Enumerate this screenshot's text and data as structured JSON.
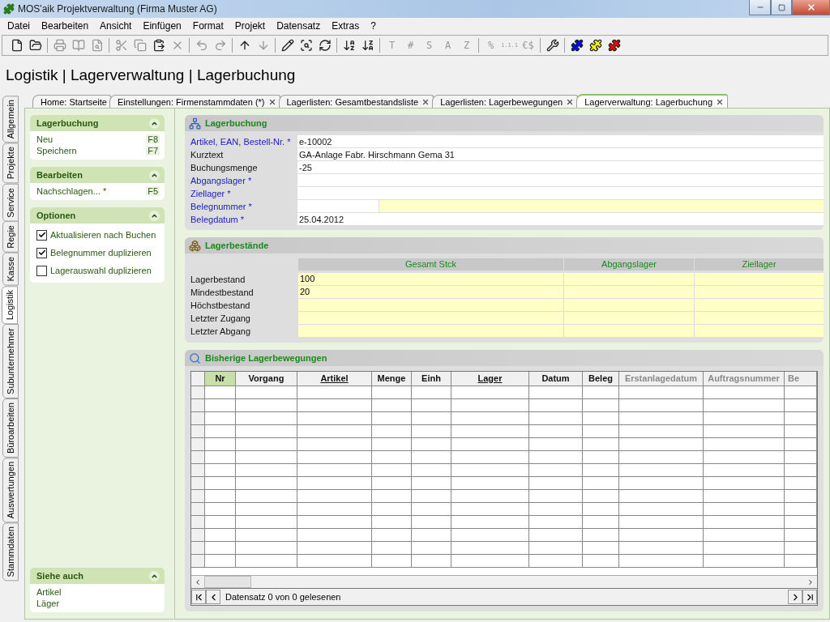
{
  "window": {
    "title": "MOS'aik Projektverwaltung (Firma Muster AG)"
  },
  "menu": [
    "Datei",
    "Bearbeiten",
    "Ansicht",
    "Einfügen",
    "Format",
    "Projekt",
    "Datensatz",
    "Extras",
    "?"
  ],
  "toolbar": [
    [
      {
        "disabled": false
      },
      {
        "disabled": false
      }
    ],
    [
      {
        "disabled": true
      },
      {
        "disabled": true
      },
      {
        "disabled": true
      }
    ],
    [
      {
        "disabled": true
      },
      {
        "disabled": true
      },
      {
        "disabled": false
      },
      {
        "disabled": true
      }
    ],
    [
      {
        "disabled": true
      },
      {
        "disabled": true
      }
    ],
    [
      {
        "disabled": false
      },
      {
        "disabled": true
      }
    ],
    [
      {
        "disabled": false
      },
      {
        "disabled": false
      },
      {
        "disabled": false
      }
    ],
    [
      {
        "disabled": false
      },
      {
        "disabled": false
      }
    ],
    [
      {
        "label": "T",
        "disabled": true
      },
      {
        "label": "#",
        "disabled": true
      },
      {
        "label": "S",
        "disabled": true
      },
      {
        "label": "A",
        "disabled": true
      },
      {
        "label": "Z",
        "disabled": true
      }
    ],
    [
      {
        "label": "%",
        "disabled": true
      },
      {
        "label": "1.1.1",
        "disabled": true
      },
      {
        "label": "€$",
        "disabled": true
      }
    ],
    [
      {
        "disabled": false
      }
    ],
    [
      {
        "color": "#0000ff"
      },
      {
        "color": "#ffff00"
      },
      {
        "color": "#ff0000"
      }
    ]
  ],
  "heading": "Logistik | Lagerverwaltung | Lagerbuchung",
  "doc_tabs": [
    {
      "label": "Home: Startseite",
      "selected": false,
      "closable": false
    },
    {
      "label": "Einstellungen: Firmenstammdaten (*)",
      "selected": false,
      "closable": true
    },
    {
      "label": "Lagerlisten: Gesamtbestandsliste",
      "selected": false,
      "closable": true
    },
    {
      "label": "Lagerlisten: Lagerbewegungen",
      "selected": false,
      "closable": true
    },
    {
      "label": "Lagerverwaltung: Lagerbuchung",
      "selected": true,
      "closable": true
    }
  ],
  "side_tabs": [
    {
      "label": "Allgemein",
      "selected": false
    },
    {
      "label": "Projekte",
      "selected": false
    },
    {
      "label": "Service",
      "selected": false
    },
    {
      "label": "Regie",
      "selected": false
    },
    {
      "label": "Kasse",
      "selected": false
    },
    {
      "label": "Logistik",
      "selected": true
    },
    {
      "label": "Subunternehmer",
      "selected": false
    },
    {
      "label": "Büroarbeiten",
      "selected": false
    },
    {
      "label": "Auswertungen",
      "selected": false
    },
    {
      "label": "Stammdaten",
      "selected": false
    }
  ],
  "task_panel": [
    {
      "title": "Lagerbuchung",
      "items": [
        {
          "label": "Neu",
          "shortcut": "F8"
        },
        {
          "label": "Speichern",
          "shortcut": "F7"
        }
      ]
    },
    {
      "title": "Bearbeiten",
      "items": [
        {
          "label": "Nachschlagen... *",
          "shortcut": "F5"
        }
      ]
    },
    {
      "title": "Optionen",
      "options": [
        {
          "label": "Aktualisieren nach Buchen",
          "checked": true
        },
        {
          "label": "Belegnummer duplizieren",
          "checked": true
        },
        {
          "label": "Lagerauswahl duplizieren",
          "checked": false
        }
      ]
    },
    {
      "title": "Siehe auch",
      "links": [
        "Artikel",
        "Läger"
      ]
    }
  ],
  "booking": {
    "title": "Lagerbuchung",
    "fields": [
      {
        "label": "Artikel, EAN, Bestell-Nr. *",
        "kind": "link",
        "inputs": [
          {
            "value": "e-10002",
            "highlighted": false
          }
        ]
      },
      {
        "label": "Kurztext",
        "kind": "plain",
        "inputs": [
          {
            "value": "GA-Anlage Fabr. Hirschmann Gema 31",
            "highlighted": false
          }
        ]
      },
      {
        "label": "Buchungsmenge",
        "kind": "plain",
        "inputs": [
          {
            "value": "-25",
            "highlighted": false
          }
        ]
      },
      {
        "label": "Abgangslager *",
        "kind": "link",
        "inputs": [
          {
            "highlighted": false
          }
        ]
      },
      {
        "label": "Ziellager *",
        "kind": "link",
        "inputs": [
          {
            "highlighted": false
          }
        ]
      },
      {
        "label": "Belegnummer *",
        "kind": "link",
        "inputs": [
          {
            "highlighted": false
          },
          {
            "highlighted": true
          }
        ]
      },
      {
        "label": "Belegdatum *",
        "kind": "link",
        "inputs": [
          {
            "value": "25.04.2012",
            "highlighted": false
          }
        ]
      }
    ]
  },
  "stock": {
    "title": "Lagerbestände",
    "columns": [
      "Gesamt Stck",
      "Abgangslager",
      "Ziellager"
    ],
    "rows": [
      {
        "label": "Lagerbestand",
        "cells": [
          "100",
          "",
          ""
        ]
      },
      {
        "label": "Mindestbestand",
        "cells": [
          "20",
          "",
          ""
        ]
      },
      {
        "label": "Höchstbestand",
        "cells": [
          "",
          "",
          ""
        ]
      },
      {
        "label": "Letzter Zugang",
        "cells": [
          "",
          "",
          ""
        ]
      },
      {
        "label": "Letzter Abgang",
        "cells": [
          "",
          "",
          ""
        ]
      }
    ]
  },
  "movements": {
    "title": "Bisherige Lagerbewegungen",
    "columns": [
      {
        "label": "Nr",
        "selected": true,
        "underlined": false,
        "disabled": false
      },
      {
        "label": "Vorgang",
        "selected": false,
        "underlined": false,
        "disabled": false
      },
      {
        "label": "Artikel",
        "selected": false,
        "underlined": true,
        "disabled": false
      },
      {
        "label": "Menge",
        "selected": false,
        "underlined": false,
        "disabled": false
      },
      {
        "label": "Einh",
        "selected": false,
        "underlined": false,
        "disabled": false
      },
      {
        "label": "Lager",
        "selected": false,
        "underlined": true,
        "disabled": false
      },
      {
        "label": "Datum",
        "selected": false,
        "underlined": false,
        "disabled": false
      },
      {
        "label": "Beleg",
        "selected": false,
        "underlined": false,
        "disabled": false
      },
      {
        "label": "Erstanlagedatum",
        "selected": false,
        "underlined": false,
        "disabled": true
      },
      {
        "label": "Auftragsnummer",
        "selected": false,
        "underlined": false,
        "disabled": true
      },
      {
        "label": "Be",
        "selected": false,
        "underlined": false,
        "disabled": true
      }
    ],
    "status": "Datensatz 0 von 0 gelesenen"
  }
}
